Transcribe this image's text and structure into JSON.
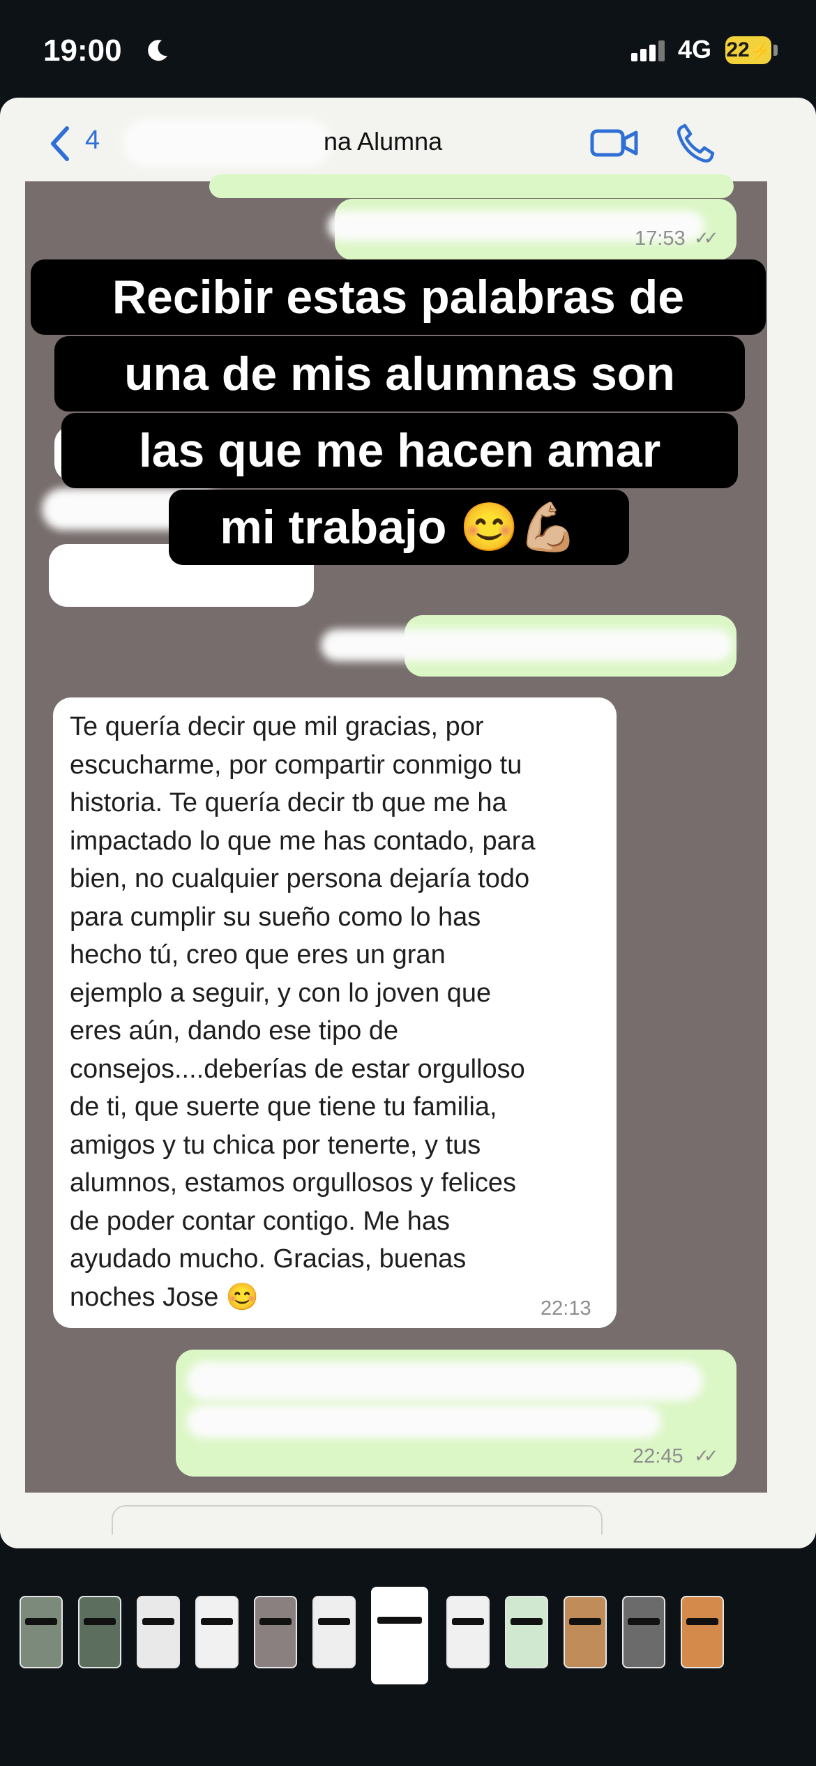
{
  "status_bar": {
    "time": "19:00",
    "network": "4G",
    "battery": "22"
  },
  "header": {
    "back_count": "4",
    "contact_name": "na Alumna"
  },
  "messages": [
    {
      "id": "m1",
      "direction": "out",
      "time": "17:53"
    },
    {
      "id": "m2",
      "direction": "out"
    },
    {
      "id": "m3",
      "direction": "in",
      "text": "Te quería decir que mil gracias, por\nescucharme, por compartir conmigo tu\nhistoria. Te quería decir tb que me ha\nimpactado lo que me has contado, para\nbien, no cualquier persona dejaría todo\npara cumplir su sueño como lo has\nhecho tú, creo que eres un gran\nejemplo a seguir, y con lo joven que\neres aún, dando ese tipo de\nconsejos....deberías de estar orgulloso\nde ti, que suerte que tiene tu familia,\namigos y tu chica por tenerte, y tus\nalumnos, estamos orgullosos y felices\nde poder contar contigo. Me has\nayudado mucho. Gracias, buenas\nnoches Jose 😊",
      "time": "22:13"
    },
    {
      "id": "m4",
      "direction": "out",
      "time": "22:45"
    }
  ],
  "overlay": {
    "lines": [
      "Recibir estas palabras de",
      "una de mis alumnas son",
      "las que me hacen amar",
      "mi trabajo 😊💪🏼"
    ]
  },
  "icons": {
    "back": "chevron-left-icon",
    "video": "video-camera-icon",
    "phone": "phone-icon",
    "moon": "moon-icon"
  },
  "colors": {
    "chat_bg": "#766d6c",
    "out_bubble": "#dcf7c6",
    "in_bubble": "#ffffff",
    "accent": "#2f6fd6",
    "battery": "#f2d13a"
  },
  "thumbnails": {
    "count": 12,
    "selected_index": 6
  }
}
